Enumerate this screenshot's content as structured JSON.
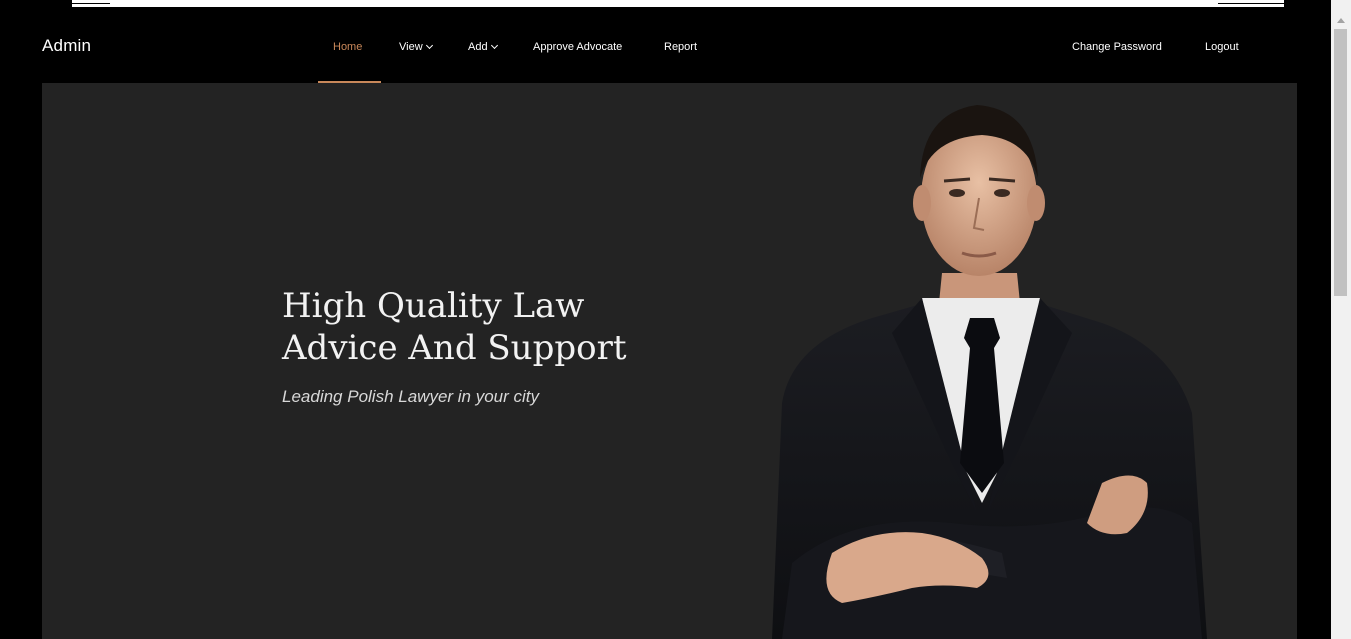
{
  "navbar": {
    "brand": "Admin",
    "items": [
      {
        "label": "Home",
        "active": true
      },
      {
        "label": "View",
        "dropdown": true
      },
      {
        "label": "Add",
        "dropdown": true
      },
      {
        "label": "Approve Advocate"
      },
      {
        "label": "Report"
      }
    ],
    "right_items": [
      {
        "label": "Change Password"
      },
      {
        "label": "Logout"
      }
    ]
  },
  "hero": {
    "title_line1": "High Quality Law",
    "title_line2": "Advice And Support",
    "subtitle": "Leading Polish Lawyer in your city"
  },
  "colors": {
    "nav_bg": "#000000",
    "hero_bg": "#232323",
    "accent": "#c9885a",
    "text": "#ffffff"
  }
}
